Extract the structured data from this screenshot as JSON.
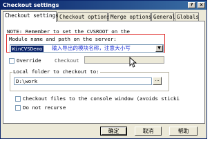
{
  "window": {
    "title": "Checkout settings"
  },
  "titlebar": {
    "help_glyph": "?",
    "close_glyph": "×"
  },
  "tabs": [
    {
      "label": "Checkout settings"
    },
    {
      "label": "Checkout options"
    },
    {
      "label": "Merge options"
    },
    {
      "label": "General"
    },
    {
      "label": "Globals"
    }
  ],
  "panel": {
    "note": "NOTE: Remember to set the CVSROOT on the",
    "module_label": "Module name and path on the server:",
    "module_value": "WinCVSDemo",
    "module_hint": "输入导出的模块名称，注意大小写",
    "override_label": "Override",
    "checkout_label": "Checkout",
    "local_folder_label": "Local folder to checkout to:",
    "local_folder_value": "D:\\work",
    "browse_label": "...",
    "console_label": "Checkout files to the console window (avoids sticki",
    "no_recurse_label": "Do not recurse"
  },
  "buttons": {
    "ok": "确定",
    "cancel": "取消",
    "help": "帮助"
  },
  "colors": {
    "title_gradient_start": "#0a246a",
    "highlight": "#0a246a",
    "annotation_box": "#e0302f",
    "hint_text": "#1b2fd6"
  },
  "icons": {
    "dropdown": "chevron-down-icon",
    "cursor": "mouse-pointer-icon"
  }
}
